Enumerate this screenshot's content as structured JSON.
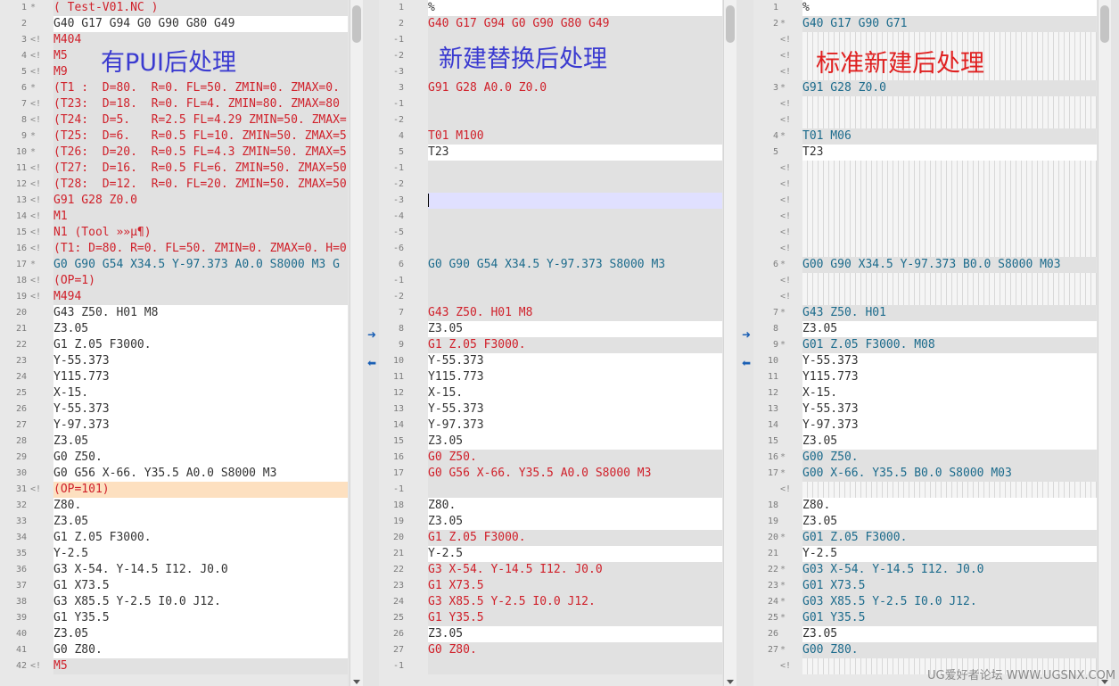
{
  "overlays": {
    "left": "有PUI后处理",
    "middle": "新建替换后处理",
    "right": "标准新建后处理"
  },
  "watermark": "UG爱好者论坛 WWW.UGSNX.COM",
  "arrows": {
    "copy_right": "➜",
    "copy_left": "⬅"
  },
  "colors": {
    "red": "#d0202a",
    "blue": "#1c6b8c",
    "black": "#333333"
  },
  "panes": [
    {
      "id": "left",
      "lines": [
        {
          "n": "1",
          "m": "*",
          "t": "( Test-V01.NC )",
          "c": "red",
          "bg": "gray"
        },
        {
          "n": "2",
          "m": "",
          "t": "G40 G17 G94 G0 G90 G80 G49",
          "c": "black",
          "bg": "white"
        },
        {
          "n": "3",
          "m": "<!",
          "t": "M404",
          "c": "red",
          "bg": "gray"
        },
        {
          "n": "4",
          "m": "<!",
          "t": "M5",
          "c": "red",
          "bg": "gray"
        },
        {
          "n": "5",
          "m": "<!",
          "t": "M9",
          "c": "red",
          "bg": "gray"
        },
        {
          "n": "6",
          "m": "*",
          "t": "(T1 :  D=80.  R=0. FL=50. ZMIN=0. ZMAX=0.",
          "c": "red",
          "bg": "gray"
        },
        {
          "n": "7",
          "m": "<!",
          "t": "(T23:  D=18.  R=0. FL=4. ZMIN=80. ZMAX=80",
          "c": "red",
          "bg": "gray"
        },
        {
          "n": "8",
          "m": "<!",
          "t": "(T24:  D=5.   R=2.5 FL=4.29 ZMIN=50. ZMAX=",
          "c": "red",
          "bg": "gray"
        },
        {
          "n": "9",
          "m": "*",
          "t": "(T25:  D=6.   R=0.5 FL=10. ZMIN=50. ZMAX=5",
          "c": "red",
          "bg": "gray"
        },
        {
          "n": "10",
          "m": "*",
          "t": "(T26:  D=20.  R=0.5 FL=4.3 ZMIN=50. ZMAX=5",
          "c": "red",
          "bg": "gray"
        },
        {
          "n": "11",
          "m": "<!",
          "t": "(T27:  D=16.  R=0.5 FL=6. ZMIN=50. ZMAX=50",
          "c": "red",
          "bg": "gray"
        },
        {
          "n": "12",
          "m": "<!",
          "t": "(T28:  D=12.  R=0. FL=20. ZMIN=50. ZMAX=50",
          "c": "red",
          "bg": "gray"
        },
        {
          "n": "13",
          "m": "<!",
          "t": "G91 G28 Z0.0",
          "c": "red",
          "bg": "gray"
        },
        {
          "n": "14",
          "m": "<!",
          "t": "M1",
          "c": "red",
          "bg": "gray"
        },
        {
          "n": "15",
          "m": "<!",
          "t": "N1 (Tool »»µ¶)",
          "c": "red",
          "bg": "gray"
        },
        {
          "n": "16",
          "m": "<!",
          "t": "(T1: D=80. R=0. FL=50. ZMIN=0. ZMAX=0. H=0",
          "c": "red",
          "bg": "gray"
        },
        {
          "n": "17",
          "m": "*",
          "t": "G0 G90 G54 X34.5 Y-97.373 A0.0 S8000 M3 G",
          "c": "blue",
          "bg": "gray"
        },
        {
          "n": "18",
          "m": "<!",
          "t": "(OP=1)",
          "c": "red",
          "bg": "gray"
        },
        {
          "n": "19",
          "m": "<!",
          "t": "M494",
          "c": "red",
          "bg": "gray"
        },
        {
          "n": "20",
          "m": "",
          "t": "G43 Z50. H01 M8",
          "c": "black",
          "bg": "white"
        },
        {
          "n": "21",
          "m": "",
          "t": "Z3.05",
          "c": "black",
          "bg": "white"
        },
        {
          "n": "22",
          "m": "",
          "t": "G1 Z.05 F3000.",
          "c": "black",
          "bg": "white"
        },
        {
          "n": "23",
          "m": "",
          "t": "Y-55.373",
          "c": "black",
          "bg": "white"
        },
        {
          "n": "24",
          "m": "",
          "t": "Y115.773",
          "c": "black",
          "bg": "white"
        },
        {
          "n": "25",
          "m": "",
          "t": "X-15.",
          "c": "black",
          "bg": "white"
        },
        {
          "n": "26",
          "m": "",
          "t": "Y-55.373",
          "c": "black",
          "bg": "white"
        },
        {
          "n": "27",
          "m": "",
          "t": "Y-97.373",
          "c": "black",
          "bg": "white"
        },
        {
          "n": "28",
          "m": "",
          "t": "Z3.05",
          "c": "black",
          "bg": "white"
        },
        {
          "n": "29",
          "m": "",
          "t": "G0 Z50.",
          "c": "black",
          "bg": "white"
        },
        {
          "n": "30",
          "m": "",
          "t": "G0 G56 X-66. Y35.5 A0.0 S8000 M3",
          "c": "black",
          "bg": "white"
        },
        {
          "n": "31",
          "m": "<!",
          "t": "(OP=101)",
          "c": "red",
          "bg": "peach"
        },
        {
          "n": "32",
          "m": "",
          "t": "Z80.",
          "c": "black",
          "bg": "white"
        },
        {
          "n": "33",
          "m": "",
          "t": "Z3.05",
          "c": "black",
          "bg": "white"
        },
        {
          "n": "34",
          "m": "",
          "t": "G1 Z.05 F3000.",
          "c": "black",
          "bg": "white"
        },
        {
          "n": "35",
          "m": "",
          "t": "Y-2.5",
          "c": "black",
          "bg": "white"
        },
        {
          "n": "36",
          "m": "",
          "t": "G3 X-54. Y-14.5 I12. J0.0",
          "c": "black",
          "bg": "white"
        },
        {
          "n": "37",
          "m": "",
          "t": "G1 X73.5",
          "c": "black",
          "bg": "white"
        },
        {
          "n": "38",
          "m": "",
          "t": "G3 X85.5 Y-2.5 I0.0 J12.",
          "c": "black",
          "bg": "white"
        },
        {
          "n": "39",
          "m": "",
          "t": "G1 Y35.5",
          "c": "black",
          "bg": "white"
        },
        {
          "n": "40",
          "m": "",
          "t": "Z3.05",
          "c": "black",
          "bg": "white"
        },
        {
          "n": "41",
          "m": "",
          "t": "G0 Z80.",
          "c": "black",
          "bg": "white"
        },
        {
          "n": "42",
          "m": "<!",
          "t": "M5",
          "c": "red",
          "bg": "gray"
        }
      ]
    },
    {
      "id": "middle",
      "lines": [
        {
          "n": "1",
          "m": "",
          "t": "%",
          "c": "black",
          "bg": "white"
        },
        {
          "n": "2",
          "m": "",
          "t": "G40 G17 G94 G0 G90 G80 G49",
          "c": "red",
          "bg": "gray"
        },
        {
          "n": "-1",
          "m": "",
          "t": "",
          "c": "black",
          "bg": "gray"
        },
        {
          "n": "-2",
          "m": "",
          "t": "",
          "c": "black",
          "bg": "gray"
        },
        {
          "n": "-3",
          "m": "",
          "t": "",
          "c": "black",
          "bg": "gray"
        },
        {
          "n": "3",
          "m": "",
          "t": "G91 G28 A0.0 Z0.0",
          "c": "red",
          "bg": "gray"
        },
        {
          "n": "-1",
          "m": "",
          "t": "",
          "c": "black",
          "bg": "gray"
        },
        {
          "n": "-2",
          "m": "",
          "t": "",
          "c": "black",
          "bg": "gray"
        },
        {
          "n": "4",
          "m": "",
          "t": "T01 M100",
          "c": "red",
          "bg": "gray"
        },
        {
          "n": "5",
          "m": "",
          "t": "T23",
          "c": "black",
          "bg": "white"
        },
        {
          "n": "-1",
          "m": "",
          "t": "",
          "c": "black",
          "bg": "gray"
        },
        {
          "n": "-2",
          "m": "",
          "t": "",
          "c": "black",
          "bg": "gray"
        },
        {
          "n": "-3",
          "m": "",
          "t": "",
          "c": "black",
          "bg": "sel",
          "cursor": true
        },
        {
          "n": "-4",
          "m": "",
          "t": "",
          "c": "black",
          "bg": "gray"
        },
        {
          "n": "-5",
          "m": "",
          "t": "",
          "c": "black",
          "bg": "gray"
        },
        {
          "n": "-6",
          "m": "",
          "t": "",
          "c": "black",
          "bg": "gray"
        },
        {
          "n": "6",
          "m": "",
          "t": "G0 G90 G54 X34.5 Y-97.373 S8000 M3",
          "c": "blue",
          "bg": "gray"
        },
        {
          "n": "-1",
          "m": "",
          "t": "",
          "c": "black",
          "bg": "gray"
        },
        {
          "n": "-2",
          "m": "",
          "t": "",
          "c": "black",
          "bg": "gray"
        },
        {
          "n": "7",
          "m": "",
          "t": "G43 Z50. H01 M8",
          "c": "red",
          "bg": "gray"
        },
        {
          "n": "8",
          "m": "",
          "t": "Z3.05",
          "c": "black",
          "bg": "white"
        },
        {
          "n": "9",
          "m": "",
          "t": "G1 Z.05 F3000.",
          "c": "red",
          "bg": "gray"
        },
        {
          "n": "10",
          "m": "",
          "t": "Y-55.373",
          "c": "black",
          "bg": "white"
        },
        {
          "n": "11",
          "m": "",
          "t": "Y115.773",
          "c": "black",
          "bg": "white"
        },
        {
          "n": "12",
          "m": "",
          "t": "X-15.",
          "c": "black",
          "bg": "white"
        },
        {
          "n": "13",
          "m": "",
          "t": "Y-55.373",
          "c": "black",
          "bg": "white"
        },
        {
          "n": "14",
          "m": "",
          "t": "Y-97.373",
          "c": "black",
          "bg": "white"
        },
        {
          "n": "15",
          "m": "",
          "t": "Z3.05",
          "c": "black",
          "bg": "white"
        },
        {
          "n": "16",
          "m": "",
          "t": "G0 Z50.",
          "c": "red",
          "bg": "gray"
        },
        {
          "n": "17",
          "m": "",
          "t": "G0 G56 X-66. Y35.5 A0.0 S8000 M3",
          "c": "red",
          "bg": "gray"
        },
        {
          "n": "-1",
          "m": "",
          "t": "",
          "c": "black",
          "bg": "gray"
        },
        {
          "n": "18",
          "m": "",
          "t": "Z80.",
          "c": "black",
          "bg": "white"
        },
        {
          "n": "19",
          "m": "",
          "t": "Z3.05",
          "c": "black",
          "bg": "white"
        },
        {
          "n": "20",
          "m": "",
          "t": "G1 Z.05 F3000.",
          "c": "red",
          "bg": "gray"
        },
        {
          "n": "21",
          "m": "",
          "t": "Y-2.5",
          "c": "black",
          "bg": "white"
        },
        {
          "n": "22",
          "m": "",
          "t": "G3 X-54. Y-14.5 I12. J0.0",
          "c": "red",
          "bg": "gray"
        },
        {
          "n": "23",
          "m": "",
          "t": "G1 X73.5",
          "c": "red",
          "bg": "gray"
        },
        {
          "n": "24",
          "m": "",
          "t": "G3 X85.5 Y-2.5 I0.0 J12.",
          "c": "red",
          "bg": "gray"
        },
        {
          "n": "25",
          "m": "",
          "t": "G1 Y35.5",
          "c": "red",
          "bg": "gray"
        },
        {
          "n": "26",
          "m": "",
          "t": "Z3.05",
          "c": "black",
          "bg": "white"
        },
        {
          "n": "27",
          "m": "",
          "t": "G0 Z80.",
          "c": "red",
          "bg": "gray"
        },
        {
          "n": "-1",
          "m": "",
          "t": "",
          "c": "black",
          "bg": "gray"
        }
      ]
    },
    {
      "id": "right",
      "lines": [
        {
          "n": "1",
          "m": "",
          "t": "%",
          "c": "black",
          "bg": "white"
        },
        {
          "n": "2",
          "m": "*",
          "t": "G40 G17 G90 G71",
          "c": "blue",
          "bg": "gray"
        },
        {
          "n": "",
          "m": "<!",
          "t": "",
          "c": "black",
          "bg": "hatch"
        },
        {
          "n": "",
          "m": "<!",
          "t": "",
          "c": "black",
          "bg": "hatch"
        },
        {
          "n": "",
          "m": "<!",
          "t": "",
          "c": "black",
          "bg": "hatch"
        },
        {
          "n": "3",
          "m": "*",
          "t": "G91 G28 Z0.0",
          "c": "blue",
          "bg": "gray"
        },
        {
          "n": "",
          "m": "<!",
          "t": "",
          "c": "black",
          "bg": "hatch"
        },
        {
          "n": "",
          "m": "<!",
          "t": "",
          "c": "black",
          "bg": "hatch"
        },
        {
          "n": "4",
          "m": "*",
          "t": "T01 M06",
          "c": "blue",
          "bg": "gray"
        },
        {
          "n": "5",
          "m": "",
          "t": "T23",
          "c": "black",
          "bg": "white"
        },
        {
          "n": "",
          "m": "<!",
          "t": "",
          "c": "black",
          "bg": "hatch"
        },
        {
          "n": "",
          "m": "<!",
          "t": "",
          "c": "black",
          "bg": "hatch"
        },
        {
          "n": "",
          "m": "<!",
          "t": "",
          "c": "black",
          "bg": "hatch"
        },
        {
          "n": "",
          "m": "<!",
          "t": "",
          "c": "black",
          "bg": "hatch"
        },
        {
          "n": "",
          "m": "<!",
          "t": "",
          "c": "black",
          "bg": "hatch"
        },
        {
          "n": "",
          "m": "<!",
          "t": "",
          "c": "black",
          "bg": "hatch"
        },
        {
          "n": "6",
          "m": "*",
          "t": "G00 G90 X34.5 Y-97.373 B0.0 S8000 M03",
          "c": "blue",
          "bg": "gray"
        },
        {
          "n": "",
          "m": "<!",
          "t": "",
          "c": "black",
          "bg": "hatch"
        },
        {
          "n": "",
          "m": "<!",
          "t": "",
          "c": "black",
          "bg": "hatch"
        },
        {
          "n": "7",
          "m": "*",
          "t": "G43 Z50. H01",
          "c": "blue",
          "bg": "gray"
        },
        {
          "n": "8",
          "m": "",
          "t": "Z3.05",
          "c": "black",
          "bg": "white"
        },
        {
          "n": "9",
          "m": "*",
          "t": "G01 Z.05 F3000. M08",
          "c": "blue",
          "bg": "gray"
        },
        {
          "n": "10",
          "m": "",
          "t": "Y-55.373",
          "c": "black",
          "bg": "white"
        },
        {
          "n": "11",
          "m": "",
          "t": "Y115.773",
          "c": "black",
          "bg": "white"
        },
        {
          "n": "12",
          "m": "",
          "t": "X-15.",
          "c": "black",
          "bg": "white"
        },
        {
          "n": "13",
          "m": "",
          "t": "Y-55.373",
          "c": "black",
          "bg": "white"
        },
        {
          "n": "14",
          "m": "",
          "t": "Y-97.373",
          "c": "black",
          "bg": "white"
        },
        {
          "n": "15",
          "m": "",
          "t": "Z3.05",
          "c": "black",
          "bg": "white"
        },
        {
          "n": "16",
          "m": "*",
          "t": "G00 Z50.",
          "c": "blue",
          "bg": "gray"
        },
        {
          "n": "17",
          "m": "*",
          "t": "G00 X-66. Y35.5 B0.0 S8000 M03",
          "c": "blue",
          "bg": "gray"
        },
        {
          "n": "",
          "m": "<!",
          "t": "",
          "c": "black",
          "bg": "hatch"
        },
        {
          "n": "18",
          "m": "",
          "t": "Z80.",
          "c": "black",
          "bg": "white"
        },
        {
          "n": "19",
          "m": "",
          "t": "Z3.05",
          "c": "black",
          "bg": "white"
        },
        {
          "n": "20",
          "m": "*",
          "t": "G01 Z.05 F3000.",
          "c": "blue",
          "bg": "gray"
        },
        {
          "n": "21",
          "m": "",
          "t": "Y-2.5",
          "c": "black",
          "bg": "white"
        },
        {
          "n": "22",
          "m": "*",
          "t": "G03 X-54. Y-14.5 I12. J0.0",
          "c": "blue",
          "bg": "gray"
        },
        {
          "n": "23",
          "m": "*",
          "t": "G01 X73.5",
          "c": "blue",
          "bg": "gray"
        },
        {
          "n": "24",
          "m": "*",
          "t": "G03 X85.5 Y-2.5 I0.0 J12.",
          "c": "blue",
          "bg": "gray"
        },
        {
          "n": "25",
          "m": "*",
          "t": "G01 Y35.5",
          "c": "blue",
          "bg": "gray"
        },
        {
          "n": "26",
          "m": "",
          "t": "Z3.05",
          "c": "black",
          "bg": "white"
        },
        {
          "n": "27",
          "m": "*",
          "t": "G00 Z80.",
          "c": "blue",
          "bg": "gray"
        },
        {
          "n": "",
          "m": "<!",
          "t": "",
          "c": "black",
          "bg": "hatch"
        }
      ]
    }
  ]
}
